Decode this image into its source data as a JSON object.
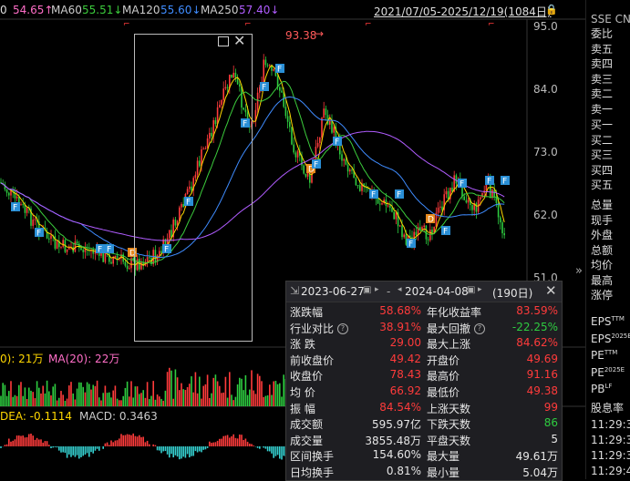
{
  "top_bar": {
    "ma_partial": "54.65↑",
    "ma60_label": "MA60",
    "ma60_value": "55.51↓",
    "ma120_label": "MA120",
    "ma120_value": "55.60↓",
    "ma250_label": "MA250",
    "ma250_value": "57.40↓",
    "date_range": "2021/07/05-2025/12/19(1084日)"
  },
  "y_axis": [
    "95.0",
    "84.0",
    "73.0",
    "62.0",
    "51.0"
  ],
  "peak_label": "93.38",
  "volume_bar": {
    "left": "0): 21万",
    "ma20": "MA(20): 22万"
  },
  "macd_bar": {
    "dea": "DEA: -0.1114",
    "macd": "MACD: 0.3463"
  },
  "markers": [
    "F",
    "F",
    "F",
    "F",
    "D",
    "F",
    "F",
    "F",
    "F",
    "F",
    "D",
    "F",
    "F",
    "F",
    "F",
    "F",
    "D",
    "F",
    "F",
    "F",
    "F"
  ],
  "popup": {
    "start_date": "2023-06-27",
    "end_date": "2024-04-08",
    "days": "(190日)",
    "separator": "-",
    "rows": [
      {
        "l1": "涨跌幅",
        "v1": "58.68%",
        "c1": "red",
        "l2": "年化收益率",
        "v2": "83.59%",
        "c2": "red"
      },
      {
        "l1": "行业对比",
        "v1": "38.91%",
        "c1": "red",
        "l2": "最大回撤",
        "v2": "-22.25%",
        "c2": "green"
      },
      {
        "l1": "涨  跌",
        "v1": "29.00",
        "c1": "red",
        "l2": "最大上涨",
        "v2": "84.62%",
        "c2": "red"
      },
      {
        "l1": "前收盘价",
        "v1": "49.42",
        "c1": "red",
        "l2": "开盘价",
        "v2": "49.69",
        "c2": "red"
      },
      {
        "l1": "收盘价",
        "v1": "78.43",
        "c1": "red",
        "l2": "最高价",
        "v2": "91.16",
        "c2": "red"
      },
      {
        "l1": "均  价",
        "v1": "66.92",
        "c1": "red",
        "l2": "最低价",
        "v2": "49.38",
        "c2": "red"
      },
      {
        "l1": "振  幅",
        "v1": "84.54%",
        "c1": "red",
        "l2": "上涨天数",
        "v2": "99",
        "c2": "red"
      },
      {
        "l1": "成交额",
        "v1": "595.97亿",
        "c1": "white",
        "l2": "下跌天数",
        "v2": "86",
        "c2": "green"
      },
      {
        "l1": "成交量",
        "v1": "3855.48万",
        "c1": "white",
        "l2": "平盘天数",
        "v2": "5",
        "c2": "white"
      },
      {
        "l1": "区间换手",
        "v1": "154.60%",
        "c1": "white",
        "l2": "最大量",
        "v2": "49.61万",
        "c2": "white"
      },
      {
        "l1": "日均换手",
        "v1": "0.81%",
        "c1": "white",
        "l2": "最小量",
        "v2": "5.04万",
        "c2": "white"
      }
    ]
  },
  "right_panel": {
    "header": "SSE CN",
    "items": [
      "委比",
      "卖五",
      "卖四",
      "卖三",
      "卖二",
      "卖一",
      "买一",
      "买二",
      "买三",
      "买四",
      "买五",
      "总量",
      "现手",
      "外盘",
      "总额",
      "均价",
      "最高",
      "涨停",
      "EPS",
      "EPS",
      "PE",
      "PE",
      "PB",
      "股息率"
    ],
    "sups": [
      "TTM",
      "2025E",
      "TTM",
      "2025E",
      "LF"
    ],
    "times": [
      "11:29:3",
      "11:29:3",
      "11:29:3",
      "11:29:4"
    ]
  },
  "colors": {
    "up": "#ff3b3b",
    "down": "#2ecc40",
    "ma5": "#ffffff",
    "ma10": "#ffd700",
    "ma60": "#3ccc3c",
    "ma120": "#3f8cff",
    "ma250": "#b05cff",
    "accent": "#ff5a5a"
  }
}
